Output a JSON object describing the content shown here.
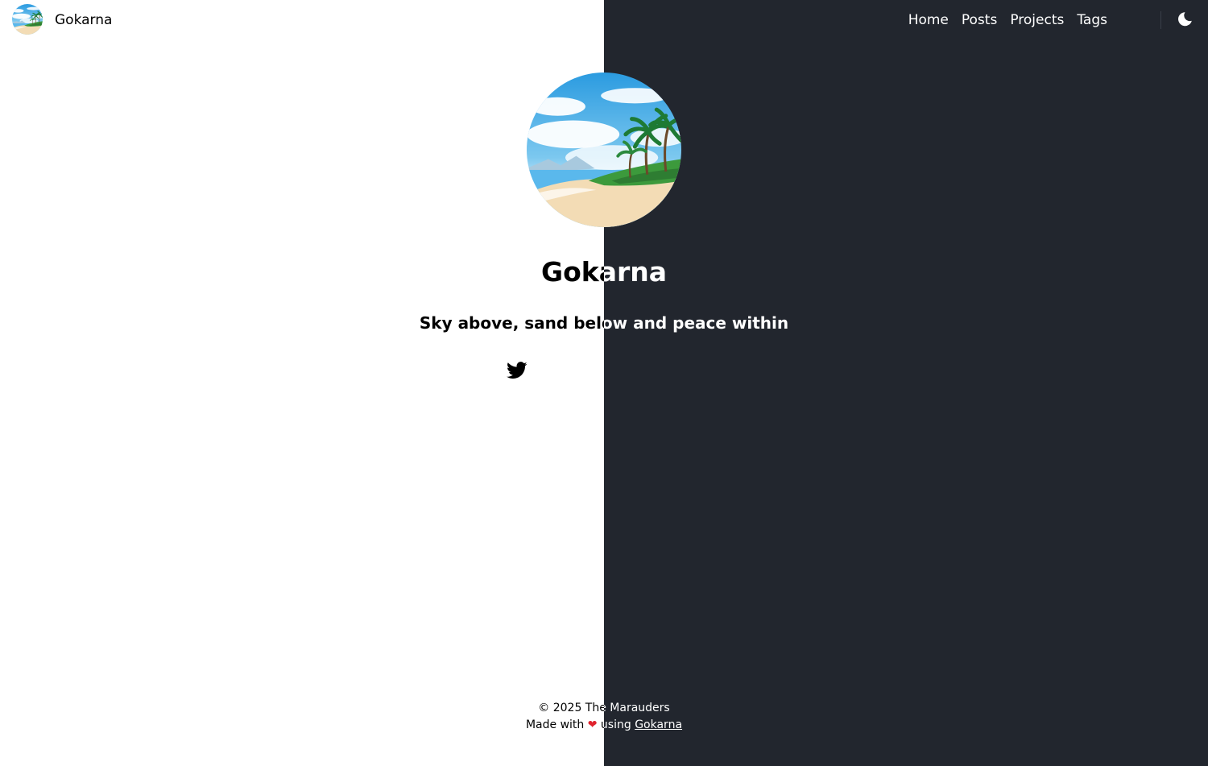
{
  "header": {
    "site_title": "Gokarna",
    "nav": [
      "Home",
      "Posts",
      "Projects",
      "Tags"
    ]
  },
  "hero": {
    "title": "Gokarna",
    "subtitle": "Sky above, sand below and peace within"
  },
  "footer": {
    "copyright": "© 2025 The Marauders",
    "made_with_prefix": "Made with",
    "heart": "❤",
    "made_with_using": "using",
    "made_with_link": "Gokarna"
  },
  "colors": {
    "dark_background": "#22262e",
    "light_background": "#ffffff",
    "heart": "#e0242e"
  },
  "icons": {
    "social": "twitter-icon",
    "theme_toggle": "moon-icon",
    "logo": "beach-logo"
  }
}
